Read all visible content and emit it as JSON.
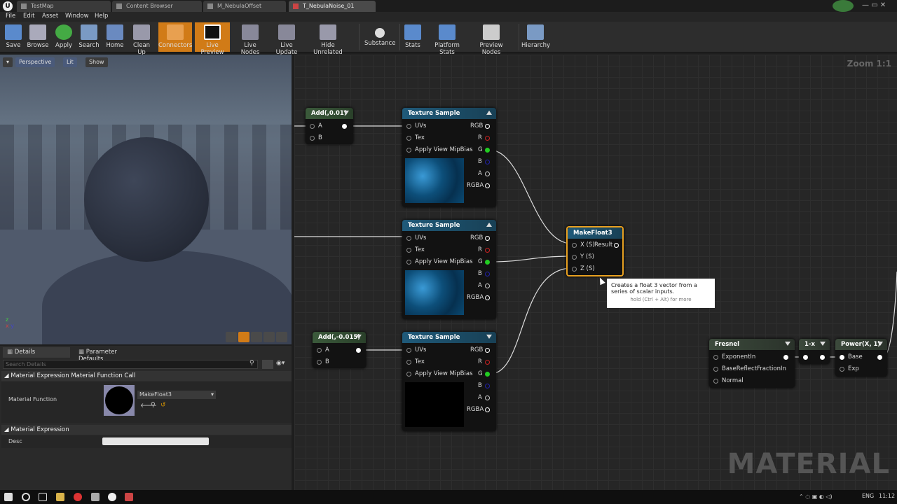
{
  "tabs": [
    {
      "label": "TestMap",
      "active": false
    },
    {
      "label": "Content Browser",
      "active": false
    },
    {
      "label": "M_NebulaOffset",
      "active": false
    },
    {
      "label": "T_NebulaNoise_01",
      "active": true
    }
  ],
  "menus": [
    "File",
    "Edit",
    "Asset",
    "Window",
    "Help"
  ],
  "toolbar": [
    "Save",
    "Browse",
    "Apply",
    "Search",
    "Home",
    "Clean Up",
    "Connectors",
    "Live Preview",
    "Live Nodes",
    "Live Update",
    "Hide Unrelated",
    "Substance",
    "Stats",
    "Platform Stats",
    "Preview Nodes",
    "Hierarchy"
  ],
  "viewport": {
    "perspective": "Perspective",
    "lit": "Lit",
    "show": "Show"
  },
  "details": {
    "tabs": [
      "Details",
      "Parameter Defaults"
    ],
    "search_placeholder": "Search Details",
    "section1": "Material Expression Material Function Call",
    "mf_label": "Material Function",
    "mf_value": "MakeFloat3",
    "section2": "Material Expression",
    "desc_label": "Desc"
  },
  "graph": {
    "zoom": "Zoom 1:1",
    "watermark": "MATERIAL",
    "add1": {
      "title": "Add(,0.01)",
      "a": "A",
      "b": "B"
    },
    "add2": {
      "title": "Add(,-0.015)",
      "a": "A",
      "b": "B"
    },
    "tex": {
      "title": "Texture Sample",
      "uvs": "UVs",
      "tex": "Tex",
      "mip": "Apply View MipBias",
      "rgb": "RGB",
      "r": "R",
      "g": "G",
      "b": "B",
      "a": "A",
      "rgba": "RGBA"
    },
    "mf3": {
      "title": "MakeFloat3",
      "x": "X (S)",
      "result": "Result",
      "y": "Y (S)",
      "z": "Z (S)"
    },
    "tooltip": {
      "line1": "Creates a float 3 vector from a series of scalar inputs.",
      "line2": "hold (Ctrl + Alt) for more"
    },
    "fresnel": {
      "title": "Fresnel",
      "exp": "ExponentIn",
      "base": "BaseReflectFractionIn",
      "normal": "Normal"
    },
    "onex": {
      "title": "1-x"
    },
    "power": {
      "title": "Power(X, 1)",
      "base": "Base",
      "exp": "Exp"
    }
  },
  "taskbar": {
    "lang": "ENG",
    "time": "11:12"
  }
}
